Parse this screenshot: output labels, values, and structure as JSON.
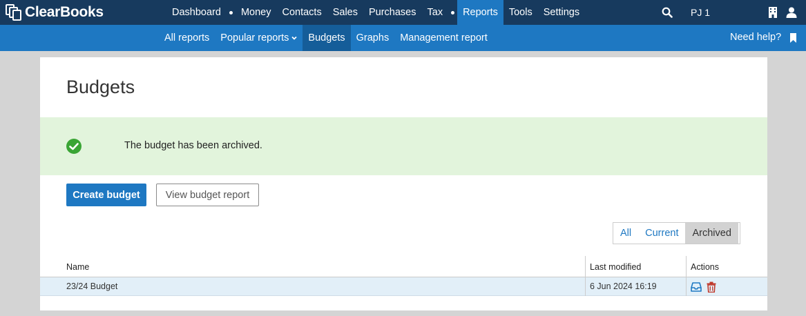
{
  "app": {
    "logo_text": "ClearBooks",
    "main_nav": [
      "Dashboard",
      "Money",
      "Contacts",
      "Sales",
      "Purchases",
      "Tax",
      "Reports",
      "Tools",
      "Settings"
    ],
    "user": "PJ 1"
  },
  "sub_nav": {
    "all_reports": "All reports",
    "popular_reports": "Popular reports",
    "budgets": "Budgets",
    "graphs": "Graphs",
    "management_report": "Management report",
    "help": "Need help?"
  },
  "page": {
    "title": "Budgets",
    "alert": "The budget has been archived.",
    "create_button": "Create budget",
    "view_report_button": "View budget report",
    "filters": [
      "All",
      "Current",
      "Archived"
    ],
    "active_filter": "Archived"
  },
  "table": {
    "headers": {
      "name": "Name",
      "last_modified": "Last modified",
      "actions": "Actions"
    },
    "rows": [
      {
        "name": "23/24 Budget",
        "last_modified": "6 Jun 2024 16:19"
      }
    ]
  },
  "colors": {
    "topbar": "#173a5e",
    "accent": "#1e78c2",
    "success_bg": "#e2f4dc",
    "success_icon": "#3aa535",
    "delete_icon": "#c0392b"
  },
  "icons": [
    "search-icon",
    "building-icon",
    "person-icon",
    "bookmark-icon",
    "check-circle-icon",
    "archive-tray-icon",
    "trash-icon",
    "chevron-down-icon"
  ]
}
